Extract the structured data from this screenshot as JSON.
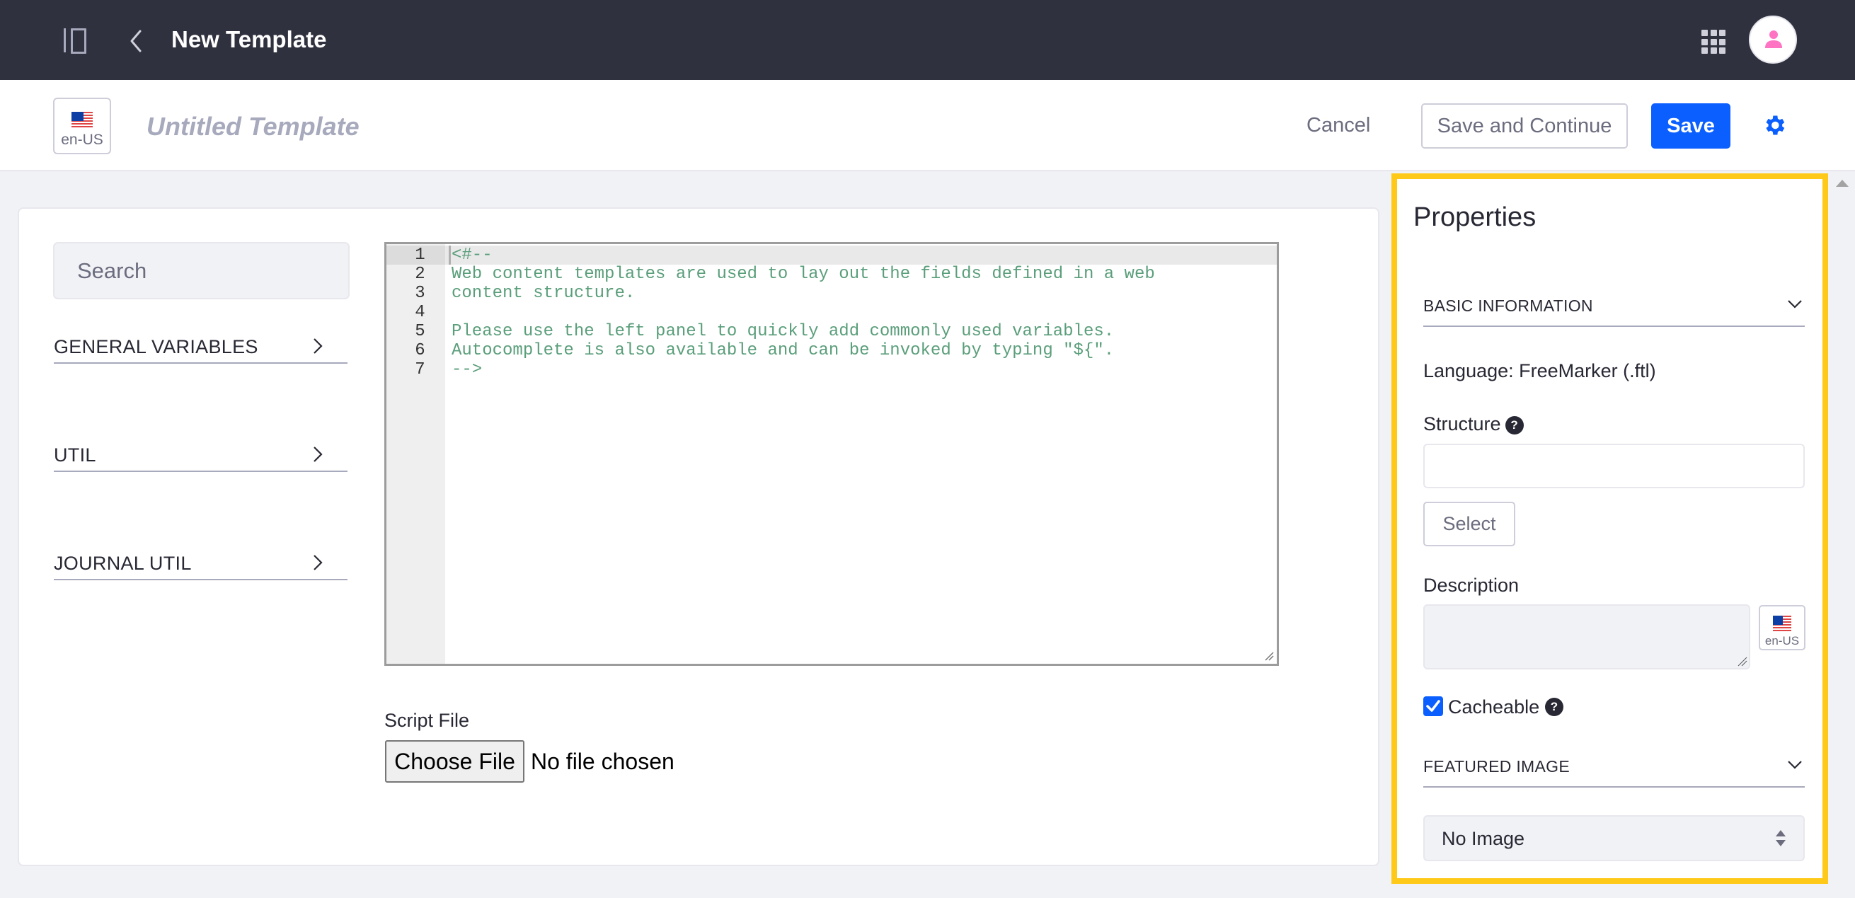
{
  "header": {
    "title": "New Template",
    "icons": {
      "sidebar_toggle": "sidebar-toggle-icon",
      "back": "chevron-left-icon",
      "apps": "apps-grid-icon",
      "avatar": "user-icon"
    }
  },
  "toolbar": {
    "locale_code": "en-US",
    "locale_flag": "us-flag-icon",
    "template_name_placeholder": "Untitled Template",
    "cancel_label": "Cancel",
    "save_continue_label": "Save and Continue",
    "save_label": "Save",
    "settings_icon": "gear-icon"
  },
  "colors": {
    "header_bg": "#30313f",
    "primary": "#0b5fff",
    "highlight_border": "#ffc919",
    "code_comment": "#5a9e7a",
    "avatar_icon": "#ff73c3"
  },
  "left_panel": {
    "search_placeholder": "Search",
    "search_value": "",
    "groups": [
      {
        "label": "GENERAL VARIABLES"
      },
      {
        "label": "UTIL"
      },
      {
        "label": "JOURNAL UTIL"
      }
    ]
  },
  "editor": {
    "lines": [
      {
        "num": "1",
        "text": "<#--"
      },
      {
        "num": "2",
        "text": "Web content templates are used to lay out the fields defined in a web"
      },
      {
        "num": "3",
        "text": "content structure."
      },
      {
        "num": "4",
        "text": ""
      },
      {
        "num": "5",
        "text": "Please use the left panel to quickly add commonly used variables."
      },
      {
        "num": "6",
        "text": "Autocomplete is also available and can be invoked by typing \"${\"."
      },
      {
        "num": "7",
        "text": "-->"
      }
    ],
    "active_line": 1
  },
  "script_file": {
    "label": "Script File",
    "button_label": "Choose File",
    "status": "No file chosen"
  },
  "properties": {
    "title": "Properties",
    "basic_information": {
      "header": "BASIC INFORMATION",
      "expanded": true,
      "language_key": "Language",
      "language_value": ": FreeMarker (.ftl)",
      "structure_label": "Structure",
      "structure_value": "",
      "select_label": "Select",
      "description_label": "Description",
      "description_value": "",
      "description_locale": "en-US",
      "cacheable_label": "Cacheable",
      "cacheable_checked": true,
      "help_glyph": "?"
    },
    "featured_image": {
      "header": "FEATURED IMAGE",
      "expanded": true,
      "selected": "No Image"
    }
  }
}
